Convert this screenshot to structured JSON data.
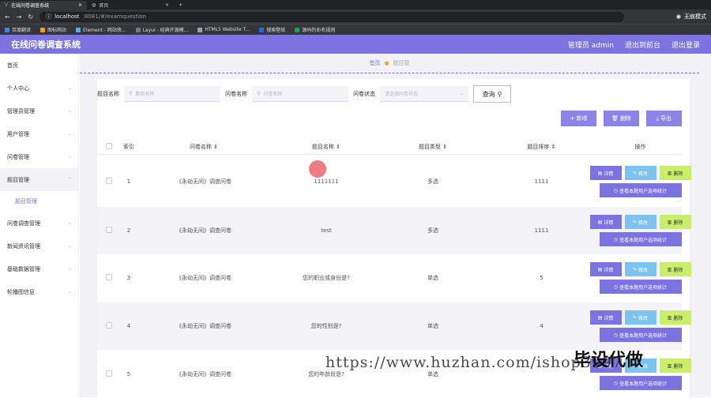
{
  "browser": {
    "tabs": [
      {
        "label": "在线问卷调查系统",
        "active": true
      },
      {
        "label": "首页",
        "active": false
      }
    ],
    "url": {
      "host": "localhost",
      "rest": ":8081/#/examquestion"
    },
    "profile": "无痕模式",
    "bookmarks": [
      "百度翻译",
      "图标网站",
      "Element - 网站快...",
      "Layui - 经典开源模...",
      "HTML5 Website T...",
      "搜索壁纸",
      "源码的命名规则"
    ]
  },
  "header": {
    "title": "在线问卷调查系统",
    "user": "管理员 admin",
    "back": "退出到前台",
    "logout": "退出登录"
  },
  "sidebar": {
    "items": [
      "首页",
      "个人中心",
      "管理员管理",
      "用户管理",
      "问卷管理",
      "题目管理",
      "题目管理",
      "问卷调查管理",
      "新闻资讯管理",
      "基础数据管理",
      "轮播图信息"
    ]
  },
  "breadcrumb": {
    "home": "首页",
    "current": "题目管"
  },
  "filters": {
    "q_label": "题目名称",
    "q_placeholder": "题目名称",
    "s_label": "问卷名称",
    "s_placeholder": "问卷名称",
    "st_label": "问卷状态",
    "st_placeholder": "请选择问卷状态",
    "search": "查询"
  },
  "toolbar": {
    "add": "+ 新增",
    "delete": "删除",
    "export": "导出"
  },
  "table": {
    "headers": [
      "索引",
      "问卷名称",
      "题目名称",
      "题目类型",
      "题目排序",
      "操作"
    ],
    "rows": [
      {
        "idx": "1",
        "survey": "《永劫无间》调查问卷",
        "question": "1111111",
        "type": "多选",
        "order": "1111"
      },
      {
        "idx": "2",
        "survey": "《永劫无间》调查问卷",
        "question": "test",
        "type": "多选",
        "order": "1111"
      },
      {
        "idx": "3",
        "survey": "《永劫无间》调查问卷",
        "question": "您的职业或身份是?",
        "type": "单选",
        "order": "5"
      },
      {
        "idx": "4",
        "survey": "《永劫无间》调查问卷",
        "question": "您的性别是?",
        "type": "单选",
        "order": "4"
      },
      {
        "idx": "5",
        "survey": "《永劫无间》调查问卷",
        "question": "您的年龄段是?",
        "type": "单选",
        "order": ""
      }
    ],
    "ops": {
      "detail": "详情",
      "edit": "修改",
      "delete": "删除",
      "stats": "查看本题用户选项统计"
    }
  },
  "watermark": {
    "url": "https://www.huzhan.com/ishop3997",
    "brand": "毕设代做"
  }
}
